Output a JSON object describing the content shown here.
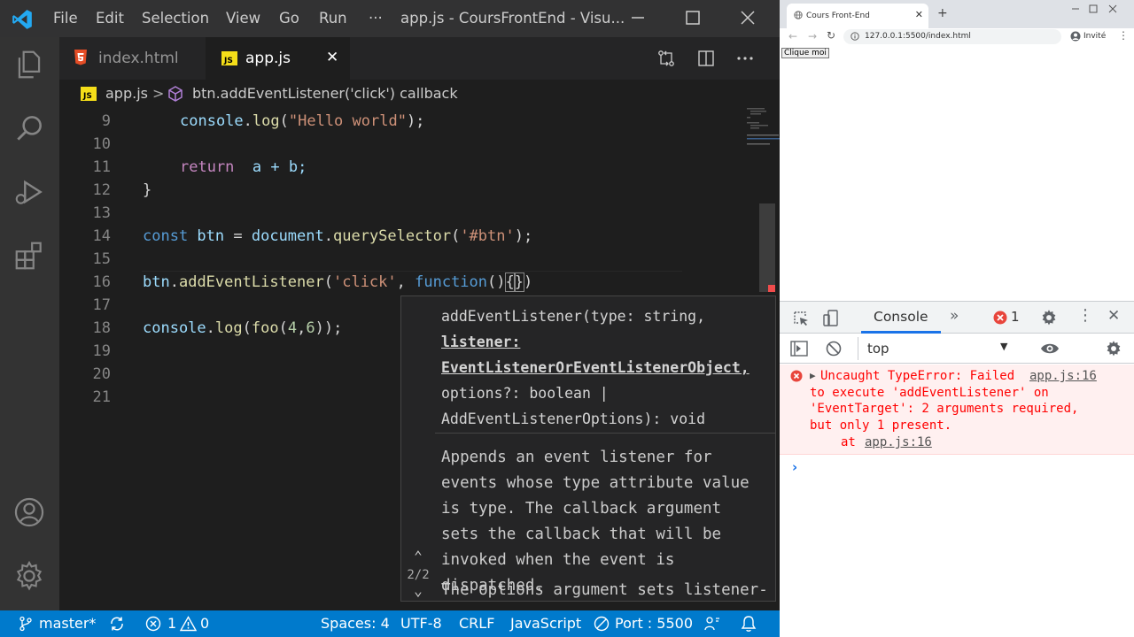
{
  "vscode": {
    "menu": [
      "File",
      "Edit",
      "Selection",
      "View",
      "Go",
      "Run",
      "···"
    ],
    "window_title": "app.js - CoursFrontEnd - Visu...",
    "tabs": [
      {
        "label": "index.html",
        "icon": "html5-icon"
      },
      {
        "label": "app.js",
        "icon": "js-icon",
        "close": "✕"
      }
    ],
    "breadcrumb": {
      "file": "app.js",
      "sep": ">",
      "symbol": "btn.addEventListener('click') callback"
    },
    "code_lines": [
      {
        "n": "9"
      },
      {
        "n": "10"
      },
      {
        "n": "11"
      },
      {
        "n": "12"
      },
      {
        "n": "13"
      },
      {
        "n": "14"
      },
      {
        "n": "15"
      },
      {
        "n": "16"
      },
      {
        "n": "17"
      },
      {
        "n": "18"
      },
      {
        "n": "19"
      },
      {
        "n": "20"
      },
      {
        "n": "21"
      }
    ],
    "code": {
      "l9": {
        "obj": "console",
        "dot": ".",
        "fn": "log",
        "open": "(",
        "str": "\"Hello world\"",
        "close": ");"
      },
      "l11": {
        "kw": "return",
        "rest": "  a + b;"
      },
      "l12": "}",
      "l14": {
        "kw": "const",
        "var": " btn",
        "eq": " = ",
        "obj": "document",
        "dot": ".",
        "fn": "querySelector",
        "open": "(",
        "str": "'#btn'",
        "close": ");"
      },
      "l16": {
        "var": "btn",
        "dot": ".",
        "fn": "addEventListener",
        "open": "(",
        "str": "'click'",
        "comma": ", ",
        "kw": "function",
        "paren": "()",
        "brace_open": "{",
        "brace_close": "}",
        "end": ")"
      },
      "l18": {
        "obj": "console",
        "dot": ".",
        "fn": "log",
        "open": "(",
        "fn2": "foo",
        "open2": "(",
        "n1": "4",
        "comma": ",",
        "n2": "6",
        "close": "));"
      }
    },
    "hover": {
      "sig_line1": "addEventListener(type: string,",
      "sig_line2": "listener:",
      "sig_line3": "EventListenerOrEventListenerObject,",
      "sig_line4": "options?: boolean |",
      "sig_line5": "AddEventListenerOptions): void",
      "doc": "Appends an event listener for events whose type attribute value is type. The callback argument sets the callback that will be invoked when the event is dispatched.",
      "doc2": "The options argument sets listener-",
      "counter": "2/2",
      "up": "⌃",
      "down": "⌄"
    },
    "status": {
      "branch": "master*",
      "errors": "1",
      "warnings": "0",
      "spaces": "Spaces: 4",
      "encoding": "UTF-8",
      "eol": "CRLF",
      "language": "JavaScript",
      "port": "Port : 5500"
    }
  },
  "chrome": {
    "tab_title": "Cours Front-End",
    "tab_close": "✕",
    "new_tab": "+",
    "url": "127.0.0.1:5500/index.html",
    "profile": "Invité",
    "page_button": "Clique moi",
    "devtools": {
      "console_tab": "Console",
      "more": "»",
      "error_count": "1",
      "context": "top",
      "error": {
        "line1": "Uncaught TypeError: Failed",
        "link": "app.js:16",
        "line2": "to execute 'addEventListener' on",
        "line3": "'EventTarget': 2 arguments required,",
        "line4": "but only 1 present.",
        "at": "at",
        "at_link": "app.js:16"
      },
      "prompt": "›"
    }
  },
  "colors": {
    "statusbar": "#007acc",
    "accent": "#1a73e8",
    "error": "#ff0000"
  }
}
